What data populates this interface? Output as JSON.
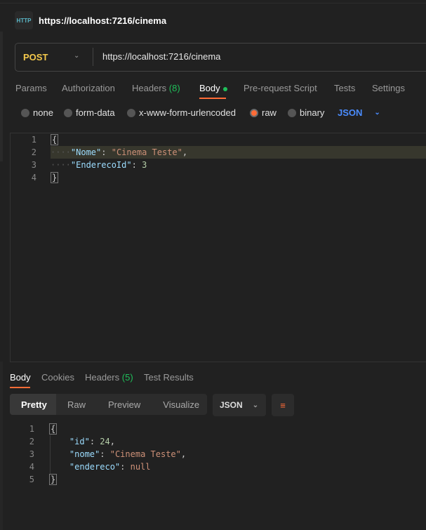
{
  "header": {
    "icon": "http-icon",
    "icon_text": "HTTP",
    "title": "https://localhost:7216/cinema"
  },
  "request": {
    "method": "POST",
    "url": "https://localhost:7216/cinema",
    "method_color": "#f5c94c"
  },
  "request_tabs": [
    {
      "label": "Params"
    },
    {
      "label": "Authorization"
    },
    {
      "label": "Headers",
      "count": "(8)"
    },
    {
      "label": "Body",
      "active": true
    },
    {
      "label": "Pre-request Script"
    },
    {
      "label": "Tests"
    },
    {
      "label": "Settings"
    }
  ],
  "body_types": [
    {
      "label": "none"
    },
    {
      "label": "form-data"
    },
    {
      "label": "x-www-form-urlencoded"
    },
    {
      "label": "raw",
      "selected": true
    },
    {
      "label": "binary"
    }
  ],
  "body_format": "JSON",
  "request_body": {
    "lines": [
      "1",
      "2",
      "3",
      "4"
    ],
    "open": "{",
    "close": "}",
    "key1": "\"Nome\"",
    "val1": "\"Cinema Teste\"",
    "key2": "\"EnderecoId\"",
    "val2": "3"
  },
  "response_tabs": [
    {
      "label": "Body",
      "active": true
    },
    {
      "label": "Cookies"
    },
    {
      "label": "Headers",
      "count": "(5)"
    },
    {
      "label": "Test Results"
    }
  ],
  "view_modes": [
    {
      "label": "Pretty",
      "active": true
    },
    {
      "label": "Raw"
    },
    {
      "label": "Preview"
    },
    {
      "label": "Visualize"
    }
  ],
  "response_format": "JSON",
  "response_body": {
    "lines": [
      "1",
      "2",
      "3",
      "4",
      "5"
    ],
    "open": "{",
    "close": "}",
    "key1": "\"id\"",
    "val1": "24",
    "key2": "\"nome\"",
    "val2": "\"Cinema Teste\"",
    "key3": "\"endereco\"",
    "val3": "null"
  },
  "colors": {
    "accent": "#ff6c37",
    "success": "#1fbf5a",
    "link": "#4a8cff"
  }
}
